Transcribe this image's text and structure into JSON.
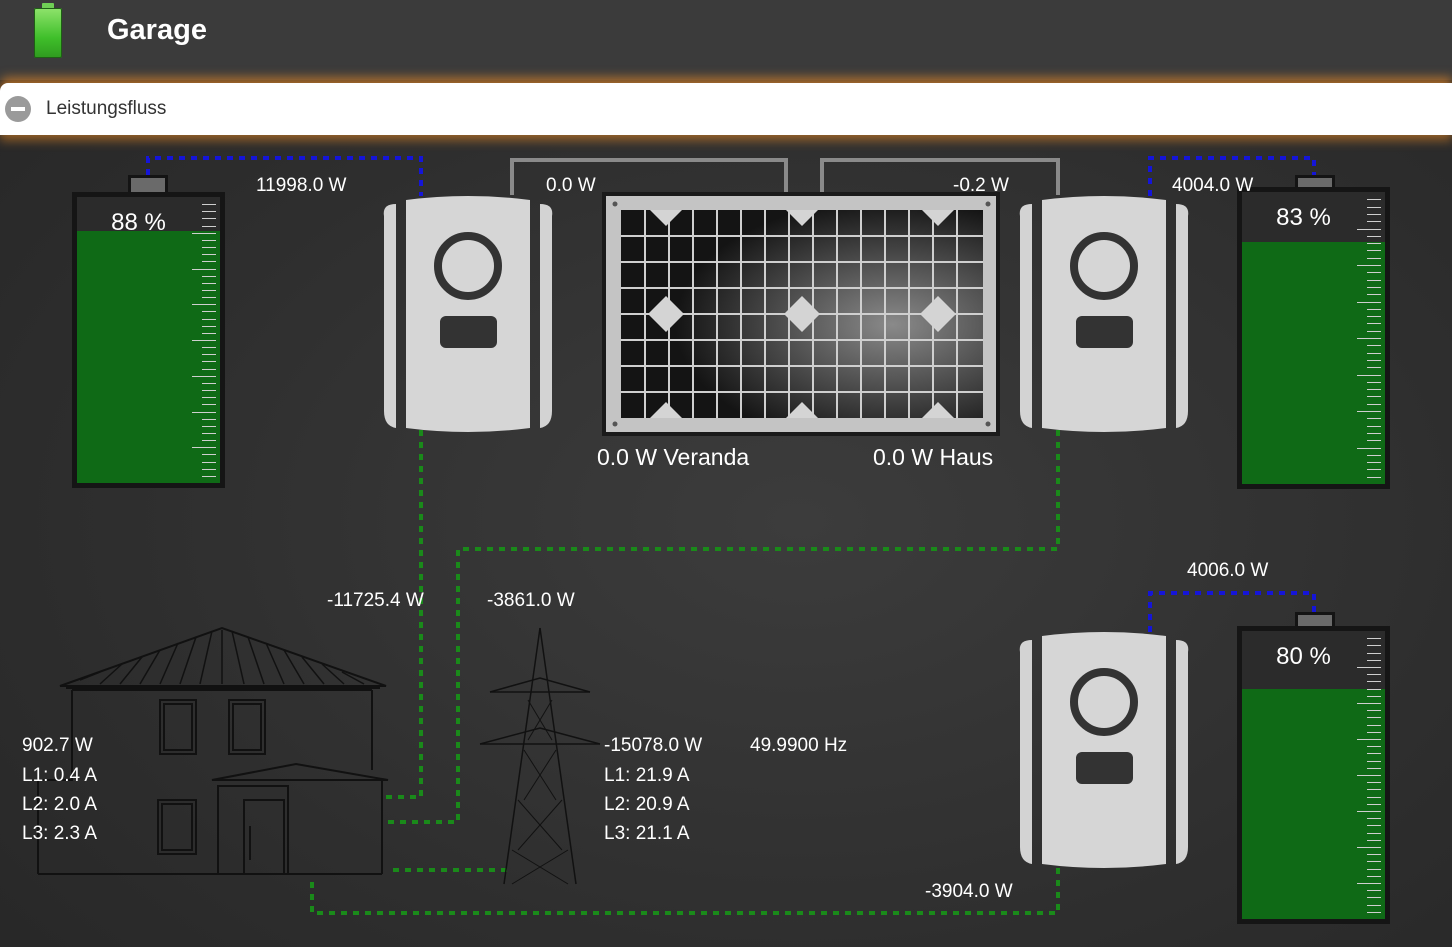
{
  "app": {
    "title": "Garage",
    "icon": "battery-icon"
  },
  "panel": {
    "title": "Leistungsfluss",
    "collapse_icon": "minus-circle-icon"
  },
  "batteries": [
    {
      "name": "battery-left",
      "percent": 88,
      "label": "88 %",
      "power": "11998.0 W"
    },
    {
      "name": "battery-right-top",
      "percent": 83,
      "label": "83 %",
      "power": "4004.0 W"
    },
    {
      "name": "battery-right-bottom",
      "percent": 80,
      "label": "80 %",
      "power": "4006.0 W"
    }
  ],
  "inverters": {
    "left_pv": "0.0 W",
    "right_pv": "-0.2 W",
    "left_ac": "-11725.4 W",
    "bottom_ac": "-3904.0 W"
  },
  "solar": {
    "veranda": "0.0 W Veranda",
    "haus": "0.0 W Haus"
  },
  "house": {
    "power": "902.7 W",
    "l1": "L1: 0.4 A",
    "l2": "L2: 2.0 A",
    "l3": "L3: 2.3 A"
  },
  "grid": {
    "transfer": "-3861.0 W",
    "power": "-15078.0 W",
    "frequency": "49.9900 Hz",
    "l1": "L1: 21.9 A",
    "l2": "L2: 20.9 A",
    "l3": "L3: 21.1 A"
  },
  "colors": {
    "dc_flow": "#1515d8",
    "ac_flow": "#1a8a1a",
    "pv_line": "#8a8a8a",
    "battery_fill": "#0f6a16",
    "accent_glow": "#ff9628"
  }
}
